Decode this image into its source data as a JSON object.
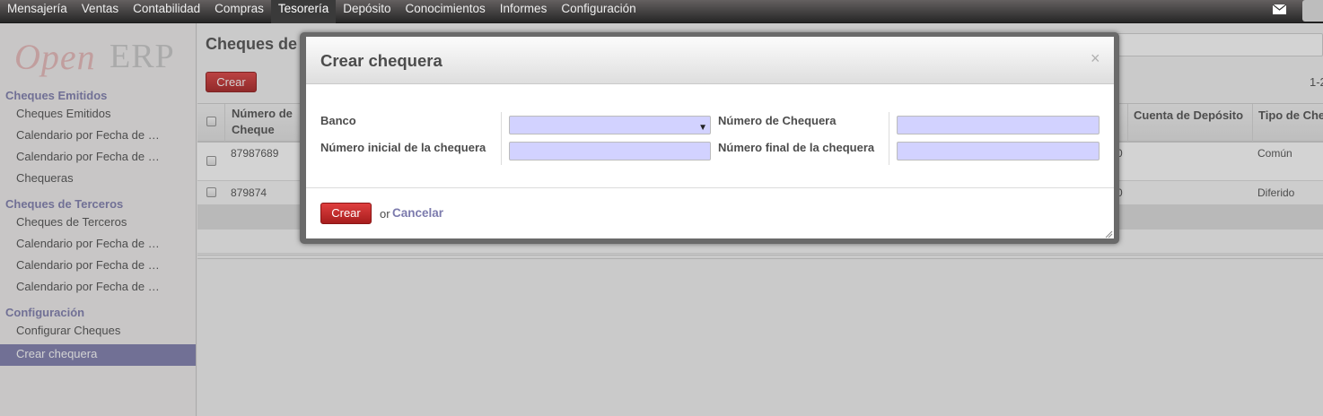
{
  "topbar": {
    "menu": [
      "Mensajería",
      "Ventas",
      "Contabilidad",
      "Compras",
      "Tesorería",
      "Depósito",
      "Conocimientos",
      "Informes",
      "Configuración"
    ],
    "active_index": 4
  },
  "logo": {
    "part1": "Open",
    "part2": "ERP"
  },
  "sidebar": {
    "section_emitidos": "Cheques Emitidos",
    "emitidos_items": [
      "Cheques Emitidos",
      "Calendario por Fecha de …",
      "Calendario por Fecha de …",
      "Chequeras"
    ],
    "section_terceros": "Cheques de Terceros",
    "terceros_items": [
      "Cheques de Terceros",
      "Calendario por Fecha de …",
      "Calendario por Fecha de …",
      "Calendario por Fecha de …"
    ],
    "section_config": "Configuración",
    "config_items": [
      "Configurar Cheques",
      "Crear chequera"
    ],
    "active_item": "Crear chequera"
  },
  "main": {
    "title": "Cheques de",
    "crear_label": "Crear",
    "pager": "1-2",
    "table": {
      "col_numero": "Número de Cheque",
      "col_numero_line1": "Número de",
      "col_numero_line2": "Cheque",
      "col_cuenta": "Cuenta de Depósito",
      "col_tipo": "Tipo de Che",
      "rows": [
        {
          "numero": "87987689",
          "partial": "0",
          "tipo": "Común"
        },
        {
          "numero": "879874",
          "partial": "0",
          "tipo": "Diferido"
        }
      ]
    }
  },
  "modal": {
    "title": "Crear chequera",
    "close": "×",
    "banco_label": "Banco",
    "banco_value": "",
    "numero_chequera_label": "Número de Chequera",
    "numero_chequera_value": "",
    "numero_inicial_label": "Número inicial de la chequera",
    "numero_inicial_value": "",
    "numero_final_label": "Número final de la chequera",
    "numero_final_value": "",
    "crear_label": "Crear",
    "or_text": "or",
    "cancel_label": "Cancelar"
  },
  "icons": {
    "mail": "envelope-icon",
    "dropdown": "caret-down-icon",
    "close": "close-icon",
    "resize": "resize-grip-icon"
  },
  "colors": {
    "accent": "#7c7bad",
    "button_red": "#b42424",
    "field_bg": "#d2d2ff"
  }
}
